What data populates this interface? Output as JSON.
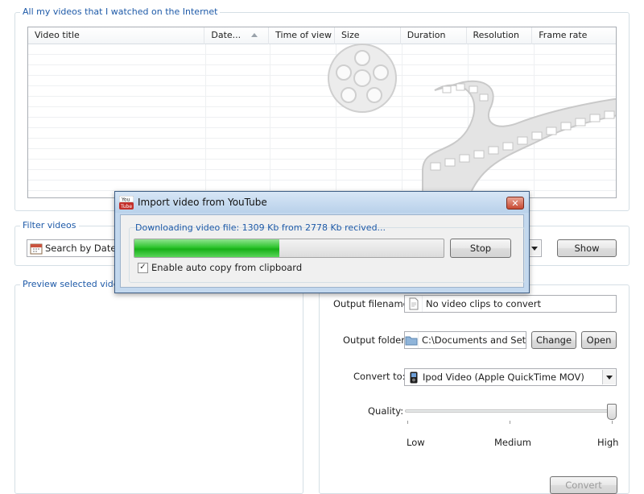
{
  "history": {
    "title": "All my videos that I watched on the Internet",
    "columns": [
      "Video title",
      "Date...",
      "Time of view",
      "Size",
      "Duration",
      "Resolution",
      "Frame rate"
    ]
  },
  "filter": {
    "title": "Filter videos",
    "mode_value": "Search by Date of",
    "show_label": "Show"
  },
  "preview": {
    "title": "Preview selected video"
  },
  "output": {
    "filename_label": "Output filename:",
    "filename_value": "No video clips to convert",
    "folder_label": "Output folder:",
    "folder_value": "C:\\Documents and Settir",
    "change_label": "Change",
    "open_label": "Open",
    "convert_label": "Convert to:",
    "convert_value": "Ipod Video (Apple QuickTime MOV)",
    "quality_label": "Quality:",
    "quality_low": "Low",
    "quality_medium": "Medium",
    "quality_high": "High",
    "quality_level": 1.0,
    "convert_button": "Convert"
  },
  "dialog": {
    "title": "Import video from YouTube",
    "status": "Downloading video file: 1309 Kb from 2778 Kb recived...",
    "progress": 0.47,
    "stop_label": "Stop",
    "checkbox_label": "Enable auto copy from clipboard",
    "checkbox_checked": true,
    "icon_text": "You Tube"
  },
  "colors": {
    "group_title": "#1e5aa8",
    "progress_fill": "#18b018",
    "dialog_frame": "#c3d8ee",
    "youtube_red": "#c4302b"
  }
}
